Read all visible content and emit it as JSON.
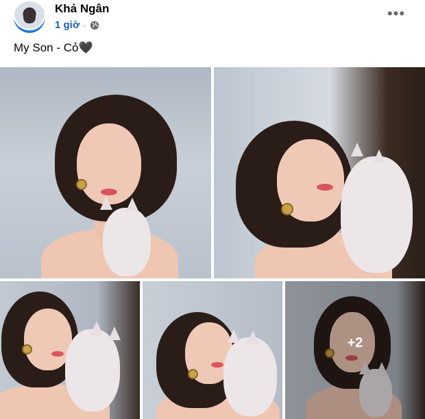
{
  "post": {
    "author": "Khả Ngân",
    "time": "1 giờ",
    "separator": "·",
    "caption": "My Son - Cỏ🖤",
    "more_menu_label": "•••"
  },
  "gallery": {
    "photos": [
      {
        "alt": "photo-1"
      },
      {
        "alt": "photo-2"
      },
      {
        "alt": "photo-3"
      },
      {
        "alt": "photo-4"
      },
      {
        "alt": "photo-5"
      }
    ],
    "more_count": "+2"
  },
  "icons": {
    "globe": "globe-icon",
    "more": "more-options-icon"
  },
  "colors": {
    "time_link": "#1b5fb7",
    "text": "#050505",
    "muted": "#65676b",
    "avatar_ring": "#1e74e8"
  }
}
